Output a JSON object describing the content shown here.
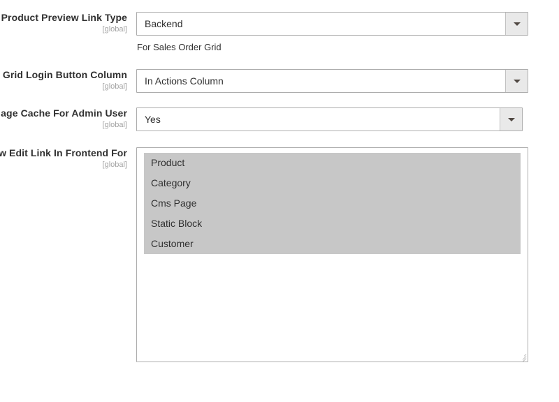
{
  "form": {
    "scope_label": "[global]",
    "fields": [
      {
        "label": "Product Preview Link Type",
        "scope": "[global]",
        "type": "select",
        "value": "Backend",
        "note": "For Sales Order Grid"
      },
      {
        "label": "Grid Login Button Column",
        "scope": "[global]",
        "type": "select",
        "value": "In Actions Column",
        "note": ""
      },
      {
        "label": "age Cache For Admin User",
        "scope": "[global]",
        "type": "select",
        "value": "Yes",
        "note": ""
      },
      {
        "label": "w Edit Link In Frontend For",
        "scope": "[global]",
        "type": "multiselect",
        "options": [
          {
            "label": "Product",
            "selected": true
          },
          {
            "label": "Category",
            "selected": true
          },
          {
            "label": "Cms Page",
            "selected": true
          },
          {
            "label": "Static Block",
            "selected": true
          },
          {
            "label": "Customer",
            "selected": true
          }
        ]
      }
    ]
  },
  "colors": {
    "page_background": "#ffffff",
    "text": "#303030",
    "scope_text": "#a3a3a3",
    "field_border": "#adadad",
    "select_button_background": "#e9e9e9",
    "caret": "#514943",
    "option_selected_background": "#c7c7c7"
  }
}
